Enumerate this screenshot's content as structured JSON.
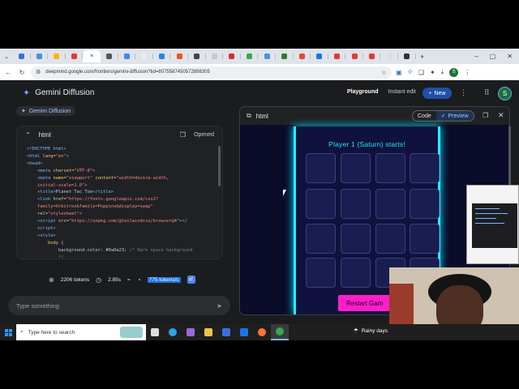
{
  "browser": {
    "tab_icon_colors": [
      "#3d6fd8",
      "#4a90e2",
      "#ffb300",
      "#e53935",
      "#c62828",
      "#555555",
      "#4285f4",
      "#e8eaed",
      "#1e88e5",
      "#f4511e",
      "#444444",
      "#c9c9c9",
      "#cc3333",
      "#34a853",
      "#4a90e2",
      "#2e7d32",
      "#ea4335",
      "#1a73e8",
      "#e53935",
      "#e53935",
      "#e53935",
      "#dddddd",
      "#333333"
    ],
    "active_tab_icon": "close-icon",
    "active_tab_close": "×",
    "new_tab": "+",
    "url": "deepmind.google.com/frontiers/gemini-diffusion?tid=8075587450572898305",
    "profile_initial": "S",
    "window_controls": [
      "–",
      "▢",
      "✕"
    ]
  },
  "app": {
    "brand": "Gemini Diffusion",
    "playground": "Playground",
    "instant_edit": "Instant edit",
    "new_button": "New",
    "user_initial": "S",
    "chip": "Gemini Diffusion",
    "code_block": {
      "lang": "html",
      "opened": "Opened",
      "lines": [
        [
          {
            "c": "tag",
            "t": "<!DOCTYPE html>"
          }
        ],
        [
          {
            "c": "tag",
            "t": "<html "
          },
          {
            "c": "attr",
            "t": "lang"
          },
          {
            "c": "txt",
            "t": "="
          },
          {
            "c": "str",
            "t": "\"en\""
          },
          {
            "c": "tag",
            "t": ">"
          }
        ],
        [
          {
            "c": "tag",
            "t": "<head>"
          }
        ],
        [
          {
            "c": "txt",
            "t": "    "
          },
          {
            "c": "tag",
            "t": "<meta "
          },
          {
            "c": "attr",
            "t": "charset"
          },
          {
            "c": "txt",
            "t": "="
          },
          {
            "c": "str",
            "t": "\"UTF-8\""
          },
          {
            "c": "tag",
            "t": ">"
          }
        ],
        [
          {
            "c": "txt",
            "t": "    "
          },
          {
            "c": "tag",
            "t": "<meta "
          },
          {
            "c": "attr",
            "t": "name"
          },
          {
            "c": "txt",
            "t": "="
          },
          {
            "c": "str",
            "t": "\"viewport\""
          },
          {
            "c": "attr",
            "t": " content"
          },
          {
            "c": "txt",
            "t": "="
          },
          {
            "c": "str",
            "t": "\"width=device-width,"
          }
        ],
        [
          {
            "c": "str",
            "t": "    initial-scale=1.0\""
          },
          {
            "c": "tag",
            "t": ">"
          }
        ],
        [
          {
            "c": "txt",
            "t": "    "
          },
          {
            "c": "tag",
            "t": "<title>"
          },
          {
            "c": "txt",
            "t": "Planet Tac Toe"
          },
          {
            "c": "tag",
            "t": "</title>"
          }
        ],
        [
          {
            "c": "txt",
            "t": "    "
          },
          {
            "c": "tag",
            "t": "<link "
          },
          {
            "c": "attr",
            "t": "href"
          },
          {
            "c": "txt",
            "t": "="
          },
          {
            "c": "str",
            "t": "\"https://fonts.googleapis.com/css2?"
          }
        ],
        [
          {
            "c": "str",
            "t": "    family=Orbitron&family=Poppins&display=swap\""
          }
        ],
        [
          {
            "c": "attr",
            "t": "    rel"
          },
          {
            "c": "txt",
            "t": "="
          },
          {
            "c": "str",
            "t": "\"stylesheet\""
          },
          {
            "c": "tag",
            "t": ">"
          }
        ],
        [
          {
            "c": "txt",
            "t": "    "
          },
          {
            "c": "tag",
            "t": "<script "
          },
          {
            "c": "attr",
            "t": "src"
          },
          {
            "c": "txt",
            "t": "="
          },
          {
            "c": "str",
            "t": "\"https://unpkg.com/@tailwindcss/browser@4\""
          },
          {
            "c": "tag",
            "t": "></"
          }
        ],
        [
          {
            "c": "tag",
            "t": "    script>"
          }
        ],
        [
          {
            "c": "txt",
            "t": "    "
          },
          {
            "c": "tag",
            "t": "<style>"
          }
        ],
        [
          {
            "c": "txt",
            "t": "        "
          },
          {
            "c": "attr",
            "t": "body"
          },
          {
            "c": "txt",
            "t": " {"
          }
        ],
        [
          {
            "c": "txt",
            "t": "            background-color: #0a0a23; "
          },
          {
            "c": "cmt",
            "t": "/* Dark space background"
          }
        ],
        [
          {
            "c": "cmt",
            "t": "            */"
          }
        ]
      ]
    },
    "stats": {
      "tokens": "2206 tokens",
      "time": "2.85s",
      "eq": "=",
      "rate": "775 tokens/s"
    },
    "prompt_placeholder": "Type something",
    "preview": {
      "title": "html",
      "code_tab": "Code",
      "preview_tab": "Preview",
      "status": "Player 1 (Saturn) starts!",
      "restart": "Restart Gam"
    }
  },
  "taskbar": {
    "search_placeholder": "Type here to search",
    "weather": "Rainy days",
    "apps": [
      {
        "name": "task-view",
        "color": "#dddddd"
      },
      {
        "name": "edge",
        "color": "#2ba4e0"
      },
      {
        "name": "copilot",
        "color": "#9a6bd8"
      },
      {
        "name": "file-explorer",
        "color": "#f2c14e"
      },
      {
        "name": "store",
        "color": "#3d6fd8"
      },
      {
        "name": "outlook",
        "color": "#1a73e8"
      },
      {
        "name": "firefox",
        "color": "#ff7139"
      },
      {
        "name": "chrome",
        "color": "#34a853",
        "active": true
      }
    ]
  }
}
